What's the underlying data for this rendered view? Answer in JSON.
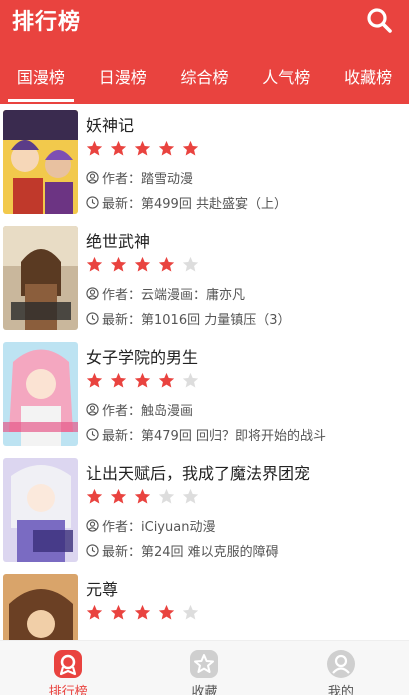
{
  "header": {
    "title": "排行榜",
    "search_icon": "search-icon"
  },
  "tabs": [
    {
      "label": "国漫榜",
      "active": true
    },
    {
      "label": "日漫榜",
      "active": false
    },
    {
      "label": "综合榜",
      "active": false
    },
    {
      "label": "人气榜",
      "active": false
    },
    {
      "label": "收藏榜",
      "active": false
    }
  ],
  "items": [
    {
      "title": "妖神记",
      "rating": 5,
      "author": "作者：踏雪动漫",
      "latest": "最新：第499回 共赴盛宴（上）"
    },
    {
      "title": "绝世武神",
      "rating": 4,
      "author": "作者：云端漫画：庸亦凡",
      "latest": "最新：第1016回 力量镇压（3）"
    },
    {
      "title": "女子学院的男生",
      "rating": 4,
      "author": "作者：触岛漫画",
      "latest": "最新：第479回 回归？即将开始的战斗"
    },
    {
      "title": "让出天赋后，我成了魔法界团宠",
      "rating": 3,
      "author": "作者：iCiyuan动漫",
      "latest": "最新：第24回 难以克服的障碍"
    },
    {
      "title": "元尊",
      "rating": 4,
      "author": "",
      "latest": ""
    }
  ],
  "bottom_nav": [
    {
      "label": "排行榜",
      "icon": "ranking-icon",
      "active": true
    },
    {
      "label": "收藏",
      "icon": "star-icon",
      "active": false
    },
    {
      "label": "我的",
      "icon": "user-icon",
      "active": false
    }
  ],
  "colors": {
    "accent": "#e9433f",
    "star_on": "#e9433f",
    "star_off": "#dddddd"
  }
}
